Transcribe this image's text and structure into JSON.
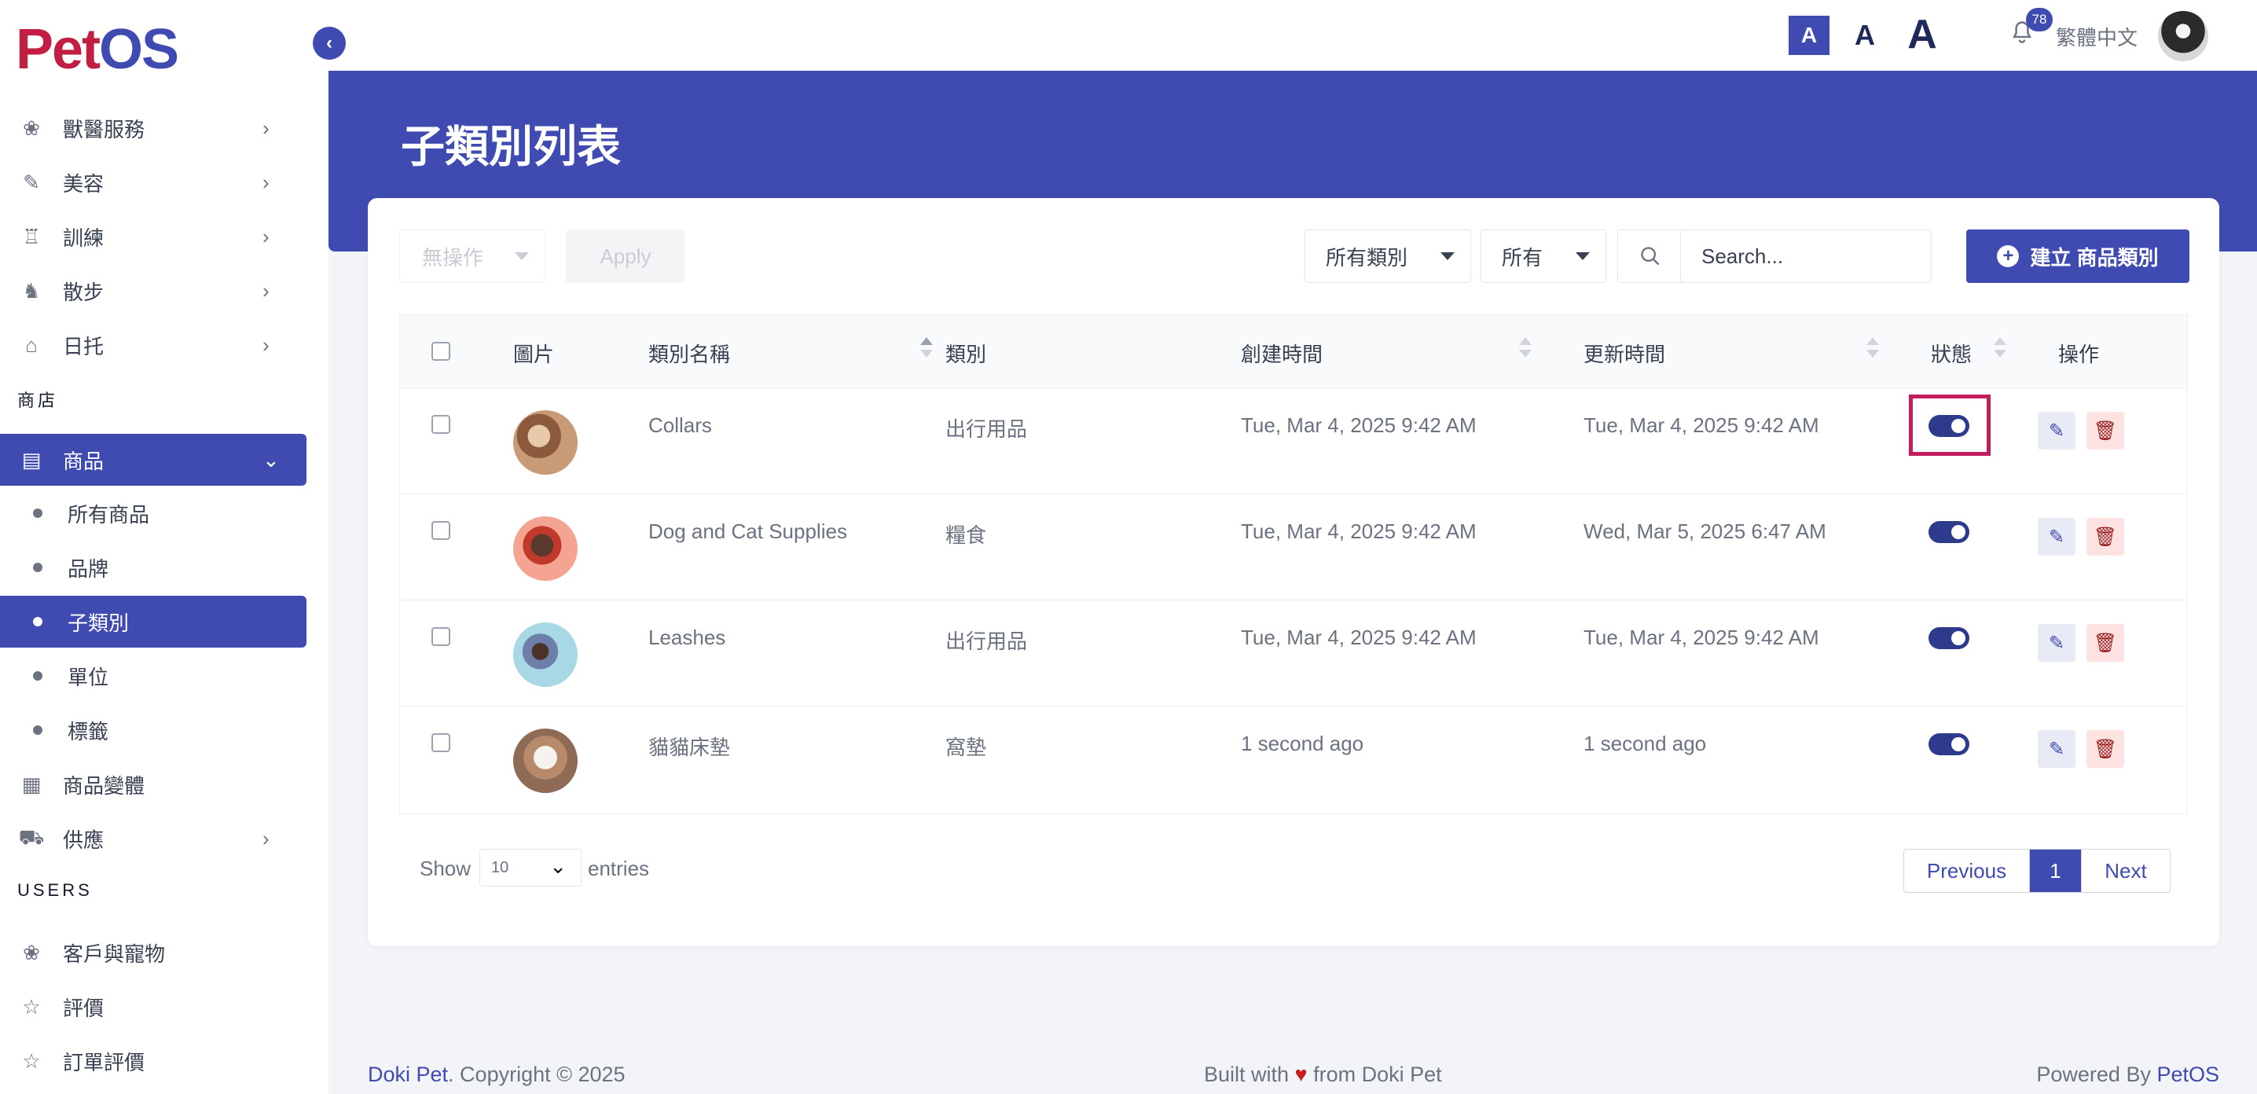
{
  "app": {
    "logo_pet": "Pet",
    "logo_os": "OS"
  },
  "sidebar": {
    "items": [
      {
        "label": "獸醫服務",
        "icon": "paw-icon"
      },
      {
        "label": "美容",
        "icon": "brush-icon"
      },
      {
        "label": "訓練",
        "icon": "trophy-icon"
      },
      {
        "label": "散步",
        "icon": "dog-walk-icon"
      },
      {
        "label": "日托",
        "icon": "daycare-icon"
      }
    ],
    "section_shop": "商店",
    "products": {
      "label": "商品",
      "icon": "store-icon"
    },
    "product_sub": [
      {
        "label": "所有商品"
      },
      {
        "label": "品牌"
      },
      {
        "label": "子類別"
      },
      {
        "label": "單位"
      },
      {
        "label": "標籤"
      }
    ],
    "variants": {
      "label": "商品變體"
    },
    "supply": {
      "label": "供應"
    },
    "section_users": "USERS",
    "customers": {
      "label": "客戶與寵物"
    },
    "reviews": {
      "label": "評價"
    },
    "order_reviews": {
      "label": "訂單評價"
    }
  },
  "topbar": {
    "font_small": "A",
    "font_medium": "A",
    "font_large": "A",
    "notification_count": "78",
    "language": "繁體中文"
  },
  "page": {
    "title": "子類別列表"
  },
  "toolbar": {
    "bulk_action": "無操作",
    "apply": "Apply",
    "category_filter": "所有類別",
    "status_filter": "所有",
    "search_placeholder": "Search...",
    "create_button": "建立 商品類別"
  },
  "table": {
    "headers": {
      "image": "圖片",
      "name": "類別名稱",
      "category": "類別",
      "created": "創建時間",
      "updated": "更新時間",
      "status": "狀態",
      "actions": "操作"
    },
    "rows": [
      {
        "name": "Collars",
        "category": "出行用品",
        "created": "Tue, Mar 4, 2025 9:42 AM",
        "updated": "Tue, Mar 4, 2025 9:42 AM",
        "status": true
      },
      {
        "name": "Dog and Cat Supplies",
        "category": "糧食",
        "created": "Tue, Mar 4, 2025 9:42 AM",
        "updated": "Wed, Mar 5, 2025 6:47 AM",
        "status": true
      },
      {
        "name": "Leashes",
        "category": "出行用品",
        "created": "Tue, Mar 4, 2025 9:42 AM",
        "updated": "Tue, Mar 4, 2025 9:42 AM",
        "status": true
      },
      {
        "name": "貓貓床墊",
        "category": "窩墊",
        "created": "1 second ago",
        "updated": "1 second ago",
        "status": true
      }
    ]
  },
  "pagination": {
    "show": "Show",
    "page_size": "10",
    "entries": "entries",
    "previous": "Previous",
    "current": "1",
    "next": "Next"
  },
  "footer": {
    "brand": "Doki Pet",
    "copyright": ". Copyright © 2025",
    "built_prefix": "Built with ",
    "heart": "♥",
    "built_suffix": " from Doki Pet",
    "powered_prefix": "Powered By ",
    "powered_brand": "PetOS"
  },
  "colors": {
    "primary": "#3f4bb1",
    "logo_red": "#c21d42",
    "highlight": "#c21d5c"
  }
}
